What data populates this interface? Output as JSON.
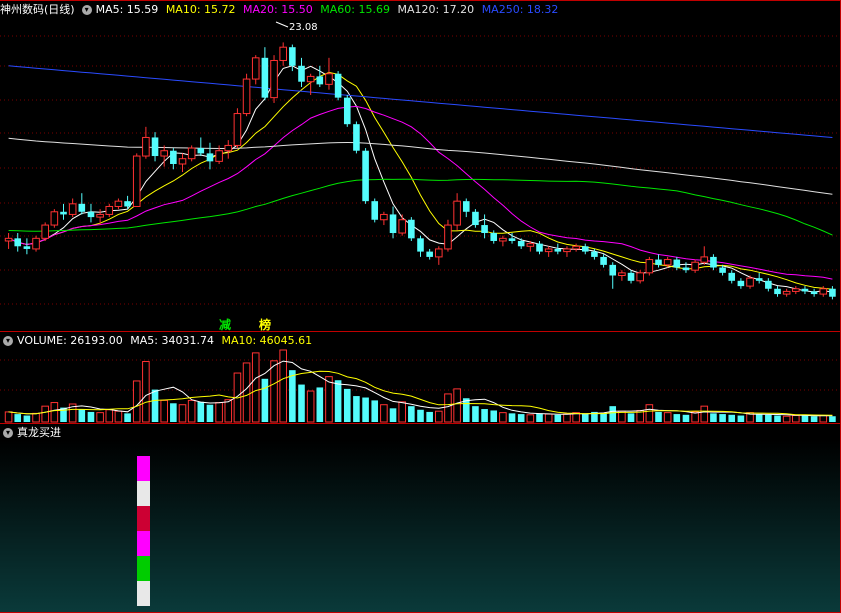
{
  "colors": {
    "up": "#ff3232",
    "down": "#54fcfc",
    "ma5": "#ffffff",
    "ma10": "#ffff00",
    "ma20": "#ff00ff",
    "ma60": "#00e600",
    "ma120": "#e0e0e0",
    "ma250": "#2a4bff",
    "border": "#c00000"
  },
  "main": {
    "stock_name": "神州数码(日线)",
    "ma5_label": "MA5: 15.59",
    "ma10_label": "MA10: 15.72",
    "ma20_label": "MA20: 15.50",
    "ma60_label": "MA60: 15.69",
    "ma120_label": "MA120: 17.20",
    "ma250_label": "MA250: 18.32",
    "peak_label": "23.08",
    "tag_reduce": "减",
    "tag_list": "榜",
    "menu_icon": "chevron-down-icon"
  },
  "volume": {
    "volume_label": "VOLUME: 26193.00",
    "ma5_label": "MA5: 34031.74",
    "ma10_label": "MA10: 46045.61",
    "menu_icon": "chevron-down-icon"
  },
  "indicator": {
    "title": "真龙买进",
    "menu_icon": "chevron-down-icon",
    "bar_segments": [
      "magenta",
      "white",
      "red",
      "magenta",
      "green",
      "white"
    ]
  },
  "chart_data": {
    "type": "candlestick",
    "price_range": [
      13.0,
      24.0
    ],
    "peak": 23.08,
    "candles": [
      [
        15.6,
        15.9,
        15.3,
        15.7
      ],
      [
        15.7,
        15.9,
        15.2,
        15.4
      ],
      [
        15.4,
        15.7,
        15.1,
        15.3
      ],
      [
        15.3,
        15.8,
        15.2,
        15.7
      ],
      [
        15.7,
        16.3,
        15.6,
        16.2
      ],
      [
        16.2,
        16.8,
        16.1,
        16.7
      ],
      [
        16.7,
        17.0,
        16.4,
        16.6
      ],
      [
        16.6,
        17.2,
        16.5,
        17.0
      ],
      [
        17.0,
        17.4,
        16.6,
        16.7
      ],
      [
        16.7,
        17.0,
        16.3,
        16.5
      ],
      [
        16.5,
        16.8,
        16.2,
        16.6
      ],
      [
        16.6,
        17.0,
        16.5,
        16.9
      ],
      [
        16.9,
        17.2,
        16.8,
        17.1
      ],
      [
        17.1,
        17.3,
        16.8,
        16.9
      ],
      [
        16.9,
        18.9,
        16.9,
        18.8
      ],
      [
        18.8,
        19.9,
        18.7,
        19.5
      ],
      [
        19.5,
        19.7,
        18.6,
        18.8
      ],
      [
        18.8,
        19.2,
        18.4,
        19.0
      ],
      [
        19.0,
        19.1,
        18.3,
        18.5
      ],
      [
        18.5,
        18.9,
        18.2,
        18.7
      ],
      [
        18.7,
        19.2,
        18.6,
        19.1
      ],
      [
        19.1,
        19.5,
        18.8,
        18.9
      ],
      [
        18.9,
        19.3,
        18.3,
        18.6
      ],
      [
        18.6,
        19.2,
        18.5,
        19.0
      ],
      [
        19.0,
        19.4,
        18.7,
        19.2
      ],
      [
        19.2,
        20.6,
        19.1,
        20.4
      ],
      [
        20.4,
        21.9,
        20.3,
        21.7
      ],
      [
        21.7,
        22.6,
        21.5,
        22.5
      ],
      [
        22.5,
        22.9,
        20.9,
        21.0
      ],
      [
        21.0,
        22.6,
        20.8,
        22.4
      ],
      [
        22.4,
        23.08,
        22.2,
        22.9
      ],
      [
        22.9,
        23.0,
        22.0,
        22.2
      ],
      [
        22.2,
        22.5,
        21.4,
        21.6
      ],
      [
        21.6,
        21.9,
        21.1,
        21.8
      ],
      [
        21.8,
        22.2,
        21.4,
        21.5
      ],
      [
        21.5,
        22.5,
        21.3,
        21.9
      ],
      [
        21.9,
        22.0,
        20.9,
        21.0
      ],
      [
        21.0,
        21.1,
        19.9,
        20.0
      ],
      [
        20.0,
        20.1,
        18.9,
        19.0
      ],
      [
        19.0,
        19.1,
        17.0,
        17.1
      ],
      [
        17.1,
        17.2,
        16.3,
        16.4
      ],
      [
        16.4,
        16.7,
        16.2,
        16.6
      ],
      [
        16.6,
        16.9,
        15.7,
        15.9
      ],
      [
        15.9,
        16.6,
        15.8,
        16.4
      ],
      [
        16.4,
        16.5,
        15.6,
        15.7
      ],
      [
        15.7,
        15.8,
        15.0,
        15.2
      ],
      [
        15.2,
        15.3,
        14.9,
        15.0
      ],
      [
        15.0,
        15.4,
        14.7,
        15.3
      ],
      [
        15.3,
        16.4,
        15.2,
        16.2
      ],
      [
        16.2,
        17.4,
        16.0,
        17.1
      ],
      [
        17.1,
        17.2,
        16.5,
        16.7
      ],
      [
        16.7,
        16.8,
        16.1,
        16.2
      ],
      [
        16.2,
        16.6,
        15.7,
        15.9
      ],
      [
        15.9,
        16.0,
        15.5,
        15.6
      ],
      [
        15.6,
        15.8,
        15.4,
        15.7
      ],
      [
        15.7,
        15.9,
        15.5,
        15.6
      ],
      [
        15.6,
        15.7,
        15.3,
        15.4
      ],
      [
        15.4,
        15.6,
        15.2,
        15.5
      ],
      [
        15.5,
        15.6,
        15.1,
        15.2
      ],
      [
        15.2,
        15.4,
        15.0,
        15.3
      ],
      [
        15.3,
        15.5,
        15.1,
        15.2
      ],
      [
        15.2,
        15.4,
        15.0,
        15.3
      ],
      [
        15.3,
        15.5,
        15.2,
        15.4
      ],
      [
        15.4,
        15.5,
        15.1,
        15.2
      ],
      [
        15.2,
        15.3,
        14.9,
        15.0
      ],
      [
        15.0,
        15.1,
        14.6,
        14.7
      ],
      [
        14.7,
        14.8,
        13.8,
        14.3
      ],
      [
        14.3,
        14.5,
        14.1,
        14.4
      ],
      [
        14.4,
        14.5,
        14.0,
        14.1
      ],
      [
        14.1,
        14.5,
        14.0,
        14.4
      ],
      [
        14.4,
        15.0,
        14.3,
        14.9
      ],
      [
        14.9,
        15.1,
        14.6,
        14.7
      ],
      [
        14.7,
        15.0,
        14.6,
        14.9
      ],
      [
        14.9,
        15.0,
        14.5,
        14.6
      ],
      [
        14.6,
        14.8,
        14.4,
        14.5
      ],
      [
        14.5,
        14.9,
        14.4,
        14.8
      ],
      [
        14.8,
        15.4,
        14.7,
        15.0
      ],
      [
        15.0,
        15.1,
        14.5,
        14.6
      ],
      [
        14.6,
        14.7,
        14.3,
        14.4
      ],
      [
        14.4,
        14.5,
        14.0,
        14.1
      ],
      [
        14.1,
        14.2,
        13.8,
        13.9
      ],
      [
        13.9,
        14.3,
        13.8,
        14.2
      ],
      [
        14.2,
        14.4,
        14.0,
        14.1
      ],
      [
        14.1,
        14.2,
        13.7,
        13.8
      ],
      [
        13.8,
        13.9,
        13.5,
        13.6
      ],
      [
        13.6,
        13.8,
        13.5,
        13.7
      ],
      [
        13.7,
        13.9,
        13.6,
        13.8
      ],
      [
        13.8,
        13.9,
        13.6,
        13.7
      ],
      [
        13.7,
        13.8,
        13.5,
        13.6
      ],
      [
        13.6,
        13.9,
        13.5,
        13.8
      ],
      [
        13.8,
        13.9,
        13.4,
        13.5
      ]
    ],
    "volumes": [
      14,
      11,
      9,
      12,
      22,
      27,
      20,
      25,
      18,
      14,
      13,
      17,
      15,
      12,
      57,
      84,
      45,
      30,
      26,
      24,
      30,
      28,
      24,
      27,
      31,
      68,
      82,
      96,
      60,
      85,
      100,
      72,
      52,
      43,
      48,
      63,
      58,
      46,
      36,
      34,
      30,
      24,
      19,
      28,
      22,
      17,
      14,
      15,
      39,
      46,
      33,
      22,
      18,
      16,
      13,
      12,
      11,
      10,
      12,
      11,
      10,
      11,
      13,
      12,
      14,
      13,
      22,
      15,
      12,
      16,
      24,
      14,
      13,
      11,
      10,
      14,
      22,
      12,
      11,
      10,
      9,
      13,
      11,
      10,
      9,
      8,
      9,
      10,
      8,
      9,
      8
    ],
    "y_max_volume": 100
  }
}
